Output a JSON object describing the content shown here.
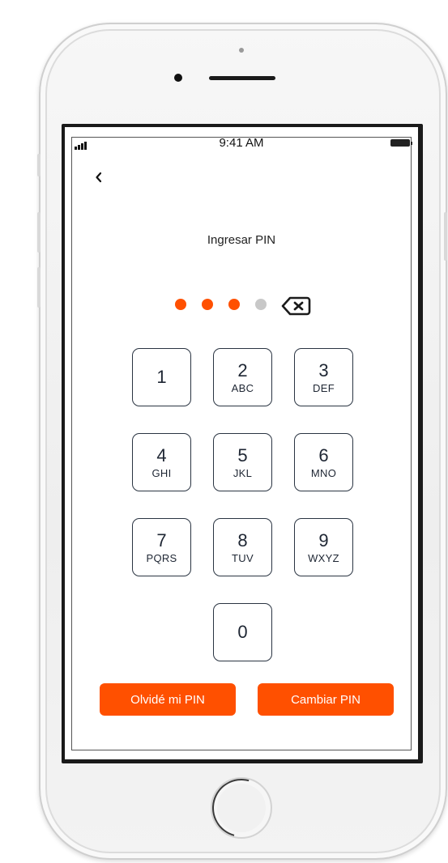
{
  "status_bar": {
    "time": "9:41 AM"
  },
  "screen": {
    "title": "Ingresar PIN",
    "pin": {
      "entered": 3,
      "length": 4
    },
    "keypad": [
      {
        "num": "1",
        "letters": ""
      },
      {
        "num": "2",
        "letters": "ABC"
      },
      {
        "num": "3",
        "letters": "DEF"
      },
      {
        "num": "4",
        "letters": "GHI"
      },
      {
        "num": "5",
        "letters": "JKL"
      },
      {
        "num": "6",
        "letters": "MNO"
      },
      {
        "num": "7",
        "letters": "PQRS"
      },
      {
        "num": "8",
        "letters": "TUV"
      },
      {
        "num": "9",
        "letters": "WXYZ"
      },
      {
        "num": "0",
        "letters": ""
      }
    ],
    "buttons": {
      "forgot_label": "Olvidé mi PIN",
      "change_label": "Cambiar PIN"
    }
  },
  "icons": {
    "back": "chevron-left-icon",
    "backspace": "backspace-icon",
    "signal": "signal-icon",
    "battery": "battery-icon"
  },
  "colors": {
    "accent": "#ff5000",
    "dot_empty": "#c8c8c8",
    "key_border": "#2a3442",
    "text": "#1e2633"
  }
}
